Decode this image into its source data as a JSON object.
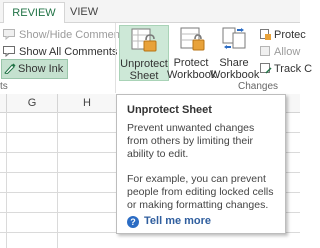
{
  "tabs": {
    "review": "REVIEW",
    "view": "VIEW"
  },
  "changes_group_left": {
    "show_hide_comments": "Show/Hide Comment",
    "show_all_comments": "Show All Comments",
    "show_ink": "Show Ink"
  },
  "big_buttons": {
    "unprotect_sheet": [
      "Unprotect",
      "Sheet"
    ],
    "protect_workbook": [
      "Protect",
      "Workbook"
    ],
    "share_workbook": [
      "Share",
      "Workbook"
    ]
  },
  "right_column": {
    "protect": "Protec",
    "allow": "Allow",
    "track": "Track C"
  },
  "group_labels": {
    "left": "ts",
    "changes": "Changes"
  },
  "columns": [
    "G",
    "H"
  ],
  "tooltip": {
    "title": "Unprotect Sheet",
    "para1": "Prevent unwanted changes from others by limiting their ability to edit.",
    "para2": "For example, you can prevent people from editing locked cells or making formatting changes.",
    "help_icon": "?",
    "tell_me_more": "Tell me more"
  },
  "colors": {
    "accent": "#217346",
    "hover": "#cde8d7",
    "link": "#2f5e9e"
  }
}
